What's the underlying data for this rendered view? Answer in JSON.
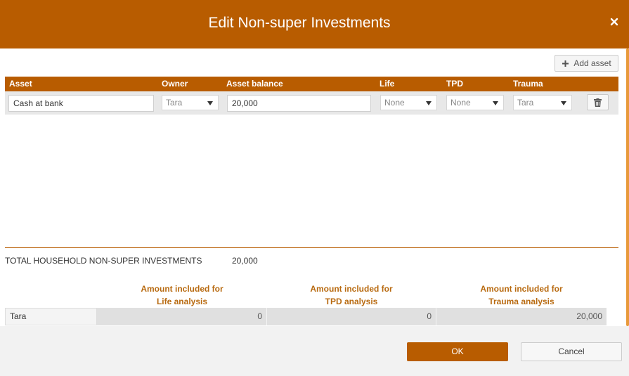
{
  "dialog": {
    "title": "Edit Non-super Investments",
    "close_icon": "close-icon"
  },
  "colors": {
    "accent": "#b85c00",
    "heading_text": "#b86a10",
    "footer_bg": "#f2f2f2"
  },
  "toolbar": {
    "add_label": "Add asset",
    "add_icon": "plus-icon"
  },
  "table": {
    "headers": {
      "asset": "Asset",
      "owner": "Owner",
      "balance": "Asset balance",
      "life": "Life",
      "tpd": "TPD",
      "trauma": "Trauma"
    },
    "rows": [
      {
        "asset": "Cash at bank",
        "owner": "Tara",
        "balance": "20,000",
        "life": "None",
        "tpd": "None",
        "trauma": "Tara",
        "delete_icon": "trash-icon"
      }
    ]
  },
  "total": {
    "label": "TOTAL HOUSEHOLD NON-SUPER INVESTMENTS",
    "value": "20,000"
  },
  "summary": {
    "headers": {
      "life": [
        "Amount included for",
        "Life analysis"
      ],
      "tpd": [
        "Amount included for",
        "TPD analysis"
      ],
      "trauma": [
        "Amount included for",
        "Trauma analysis"
      ]
    },
    "rows": [
      {
        "name": "Tara",
        "life": "0",
        "tpd": "0",
        "trauma": "20,000"
      }
    ]
  },
  "footer": {
    "ok_label": "OK",
    "cancel_label": "Cancel"
  }
}
